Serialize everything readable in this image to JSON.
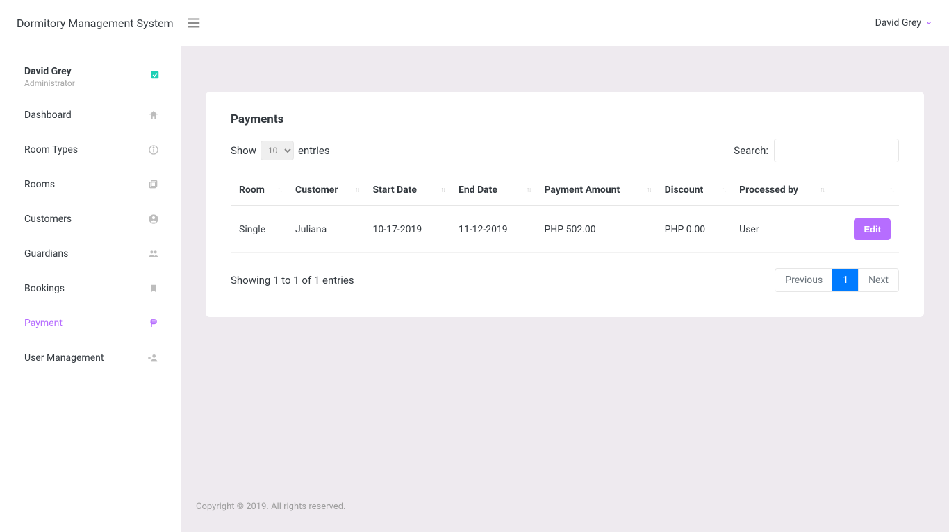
{
  "app": {
    "title": "Dormitory Management System"
  },
  "header": {
    "user_name": "David Grey"
  },
  "profile": {
    "name": "David Grey",
    "role": "Administrator"
  },
  "sidebar": {
    "items": [
      {
        "label": "Dashboard"
      },
      {
        "label": "Room Types"
      },
      {
        "label": "Rooms"
      },
      {
        "label": "Customers"
      },
      {
        "label": "Guardians"
      },
      {
        "label": "Bookings"
      },
      {
        "label": "Payment"
      },
      {
        "label": "User Management"
      }
    ]
  },
  "page": {
    "title": "Payments",
    "length_menu": {
      "show": "Show",
      "entries": "entries",
      "value": "10"
    },
    "search_label": "Search:",
    "columns": [
      "Room",
      "Customer",
      "Start Date",
      "End Date",
      "Payment Amount",
      "Discount",
      "Processed by",
      ""
    ],
    "rows": [
      {
        "room": "Single",
        "customer": "Juliana",
        "start": "10-17-2019",
        "end": "11-12-2019",
        "amount": "PHP 502.00",
        "discount": "PHP 0.00",
        "processed_by": "User",
        "action": "Edit"
      }
    ],
    "info": "Showing 1 to 1 of 1 entries",
    "pager": {
      "prev": "Previous",
      "next": "Next",
      "current": "1"
    }
  },
  "footer": {
    "text": "Copyright © 2019. All rights reserved."
  }
}
